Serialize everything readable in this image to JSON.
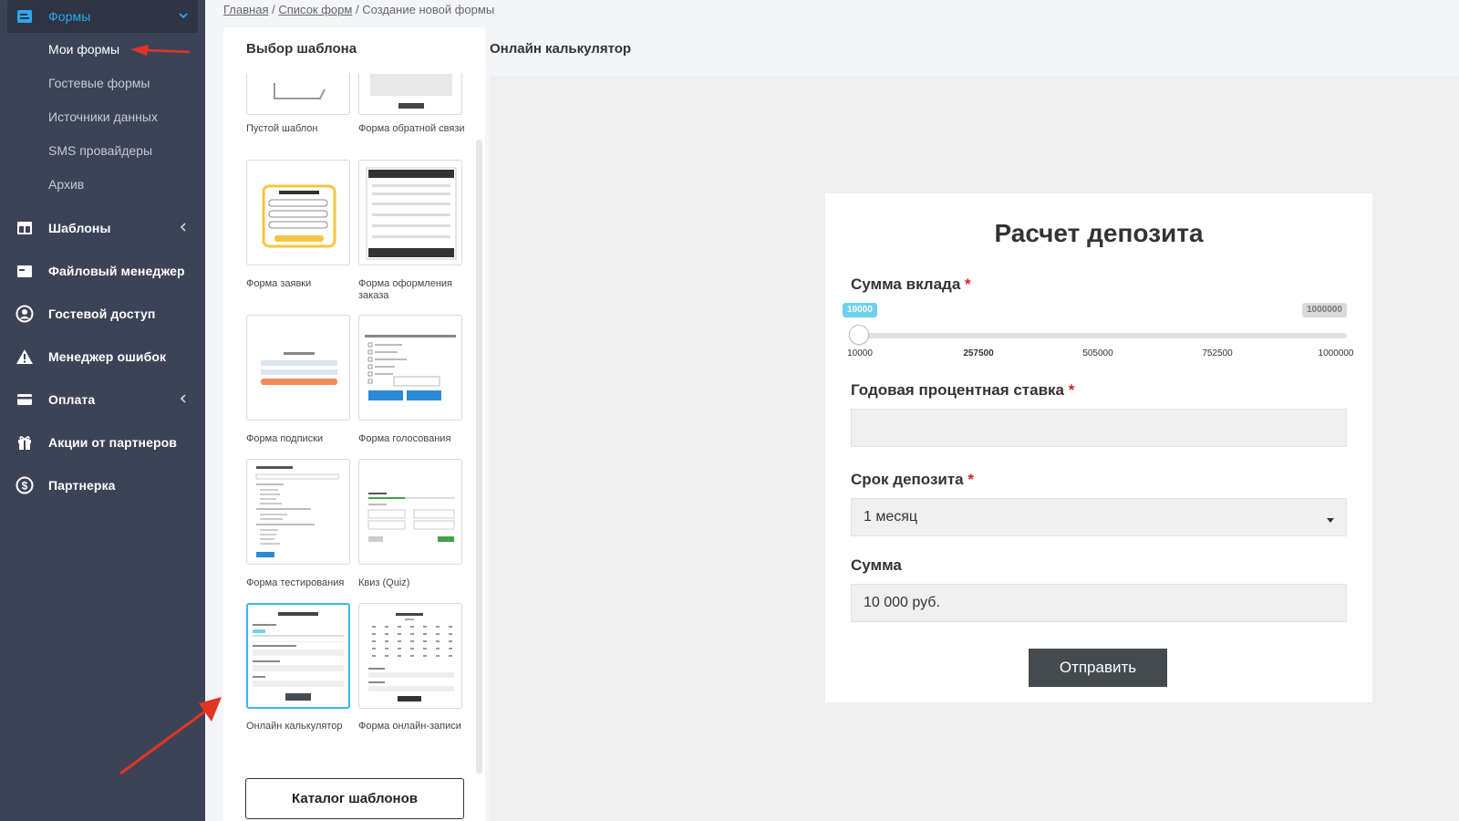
{
  "sidebar": {
    "forms": {
      "label": "Формы",
      "icon": "forms-icon"
    },
    "sub_items": [
      "Мои формы",
      "Гостевые формы",
      "Источники данных",
      "SMS провайдеры",
      "Архив"
    ],
    "items": [
      {
        "label": "Шаблоны",
        "icon": "template-icon",
        "expandable": true
      },
      {
        "label": "Файловый менеджер",
        "icon": "folder-icon",
        "expandable": false
      },
      {
        "label": "Гостевой доступ",
        "icon": "user-circle-icon",
        "expandable": false
      },
      {
        "label": "Менеджер ошибок",
        "icon": "warning-icon",
        "expandable": false
      },
      {
        "label": "Оплата",
        "icon": "credit-card-icon",
        "expandable": true
      },
      {
        "label": "Акции от партнеров",
        "icon": "gift-icon",
        "expandable": false
      },
      {
        "label": "Партнерка",
        "icon": "dollar-icon",
        "expandable": false
      }
    ]
  },
  "breadcrumb": {
    "home": "Главная",
    "forms_list": "Список форм",
    "current": "Создание новой формы",
    "separator": "/"
  },
  "templates_panel": {
    "title": "Выбор шаблона",
    "templates": [
      "Пустой шаблон",
      "Форма обратной связи",
      "Форма заявки",
      "Форма оформления заказа",
      "Форма подписки",
      "Форма голосования",
      "Форма тестирования",
      "Квиз (Quiz)",
      "Онлайн калькулятор",
      "Форма онлайн-записи"
    ],
    "selected": "Онлайн калькулятор",
    "catalog_button": "Каталог шаблонов"
  },
  "preview": {
    "title": "Онлайн калькулятор",
    "form": {
      "heading": "Расчет депозита",
      "fields": {
        "amount": {
          "label": "Сумма вклада",
          "required": "*",
          "min": 10000,
          "max": 1000000,
          "value": 10000,
          "min_bubble": "10000",
          "max_bubble": "1000000",
          "ticks": [
            "10000",
            "257500",
            "505000",
            "752500",
            "1000000"
          ]
        },
        "rate": {
          "label": "Годовая процентная ставка",
          "required": "*",
          "value": ""
        },
        "term": {
          "label": "Срок депозита",
          "required": "*",
          "value": "1 месяц"
        },
        "sum": {
          "label": "Сумма",
          "value": "10 000 руб."
        }
      },
      "submit": "Отправить"
    }
  },
  "colors": {
    "sidebar_bg": "#3d4357",
    "accent": "#29a8f0",
    "selected_border": "#38b7e8",
    "required": "#e02020",
    "button_dark": "#454a4f",
    "arrow": "#e03524"
  }
}
